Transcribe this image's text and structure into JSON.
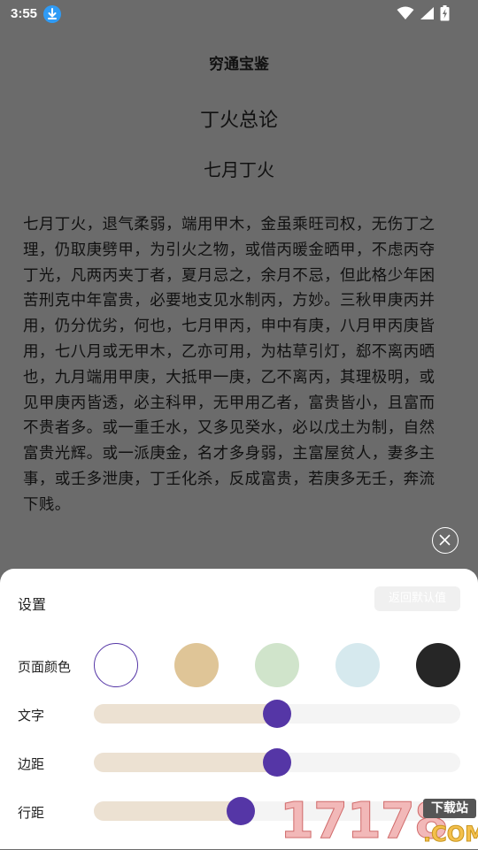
{
  "status": {
    "time": "3:55",
    "icons": [
      "download-icon",
      "wifi-icon",
      "signal-icon",
      "battery-charging-icon"
    ]
  },
  "reader": {
    "book_title": "穷通宝鉴",
    "chapter_title": "丁火总论",
    "section_title": "七月丁火",
    "body": "七月丁火，退气柔弱，端用甲木，金虽乘旺司权，无伤丁之理，仍取庚劈甲，为引火之物，或借丙暖金晒甲，不虑丙夺丁光，凡两丙夹丁者，夏月忌之，余月不忌，但此格少年困苦刑克中年富贵，必要地支见水制丙，方妙。三秋甲庚丙并用，仍分优劣，何也，七月甲丙，申中有庚，八月甲丙庚皆用，七八月或无甲木，乙亦可用，为枯草引灯，郄不离丙晒也，九月端用甲庚，大抵甲一庚，乙不离丙，其理极明，或见甲庚丙皆透，必主科甲，无甲用乙者，富贵皆小，且富而不贵者多。或一重壬水，又多见癸水，必以戊土为制，自然富贵光辉。或一派庚金，名才多身弱，主富屋贫人，妻多主事，或壬多泄庚，丁壬化杀，反成富贵，若庚多无壬，奔流下贱。"
  },
  "settings": {
    "title": "设置",
    "reset_label": "返回默认值",
    "page_color_label": "页面颜色",
    "swatches": [
      "#ffffff",
      "#dfc597",
      "#d0e4cb",
      "#d6e9ee",
      "#262626"
    ],
    "selected_swatch": 0,
    "text_label": "文字",
    "text_level": 0.5,
    "margin_label": "边距",
    "margin_level": 0.5,
    "line_spacing_label": "行距",
    "line_spacing_level": 0.4,
    "accent_color": "#5536a6"
  },
  "watermark": {
    "digits": "17178",
    "badge": "下载站",
    "suffix": ".COM"
  }
}
